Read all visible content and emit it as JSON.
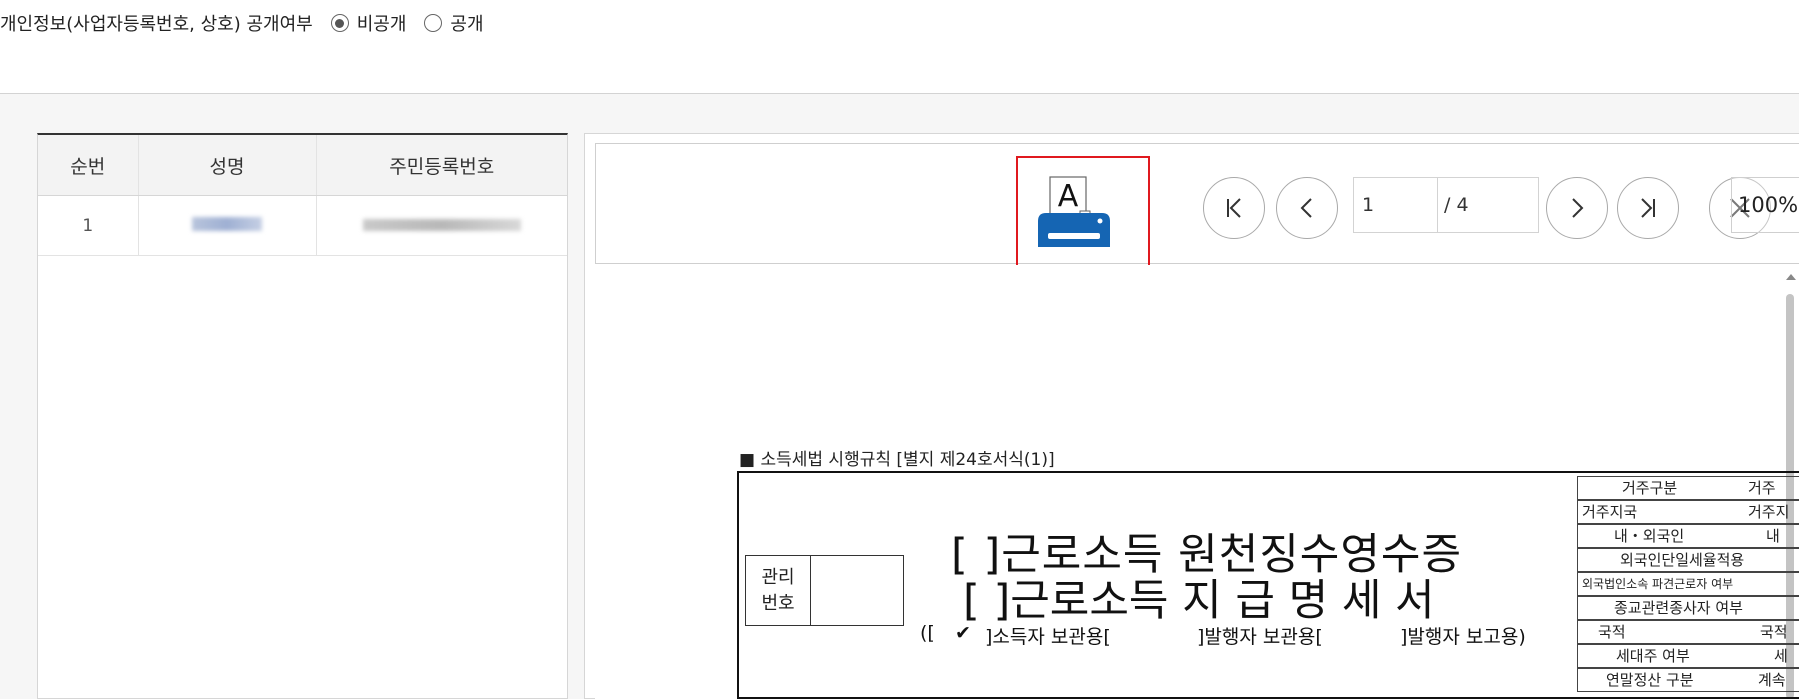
{
  "privacy": {
    "label": "개인정보(사업자등록번호, 상호) 공개여부",
    "options": [
      {
        "label": "비공개",
        "selected": true
      },
      {
        "label": "공개",
        "selected": false
      }
    ]
  },
  "list": {
    "columns": [
      "순번",
      "성명",
      "주민등록번호"
    ],
    "rows": [
      {
        "no": "1",
        "name": "(blurred)",
        "rrn": "(blurred)"
      }
    ]
  },
  "viewer": {
    "toolbar": {
      "print_icon": "printer-icon",
      "first_icon": "first-page-icon",
      "prev_icon": "prev-page-icon",
      "next_icon": "next-page-icon",
      "last_icon": "last-page-icon",
      "close_icon": "close-icon",
      "current_page": "1",
      "total_pages": "/ 4",
      "zoom": "100%"
    },
    "highlight_color": "#e0191f"
  },
  "document": {
    "rule": "■ 소득세법 시행규칙 [별지 제24호서식(1)]",
    "mgmt_label_1": "관리",
    "mgmt_label_2": "번호",
    "title_line1": "[  ]근로소득 원천징수영수증",
    "title_line2": "[  ]근로소득 지 급 명 세 서",
    "copy_line": {
      "open": "([",
      "check": "✔",
      "holder": "]소득자 보관용[",
      "issuer": "]발행자 보관용[",
      "report": "]발행자 보고용)"
    },
    "side_rows": [
      {
        "a": "거주구분",
        "b": "거주"
      },
      {
        "a": "거주지국",
        "b": "거주지"
      },
      {
        "a": "내・외국인",
        "b": "내"
      },
      {
        "a": "외국인단일세율적용",
        "b": ""
      },
      {
        "a": "외국법인소속 파견근로자 여부",
        "b": ""
      },
      {
        "a": "종교관련종사자 여부",
        "b": ""
      },
      {
        "a": "국적",
        "b": "국적"
      },
      {
        "a": "세대주 여부",
        "b": "세"
      },
      {
        "a": "연말정산 구분",
        "b": "계속"
      }
    ]
  }
}
